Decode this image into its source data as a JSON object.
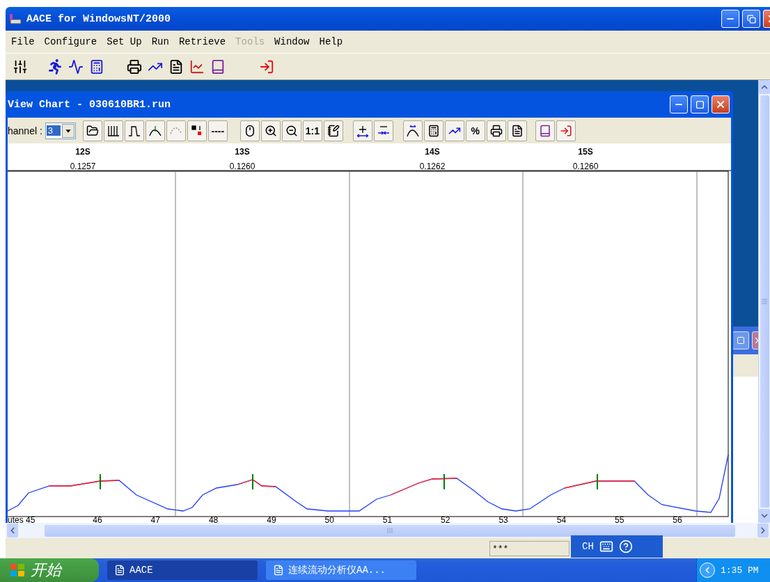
{
  "window": {
    "title": "AACE for WindowsNT/2000"
  },
  "menu": [
    {
      "label": "File",
      "disabled": false
    },
    {
      "label": "Configure",
      "disabled": false
    },
    {
      "label": "Set Up",
      "disabled": false
    },
    {
      "label": "Run",
      "disabled": false
    },
    {
      "label": "Retrieve",
      "disabled": false
    },
    {
      "label": "Tools",
      "disabled": true
    },
    {
      "label": "Window",
      "disabled": false
    },
    {
      "label": "Help",
      "disabled": false
    }
  ],
  "child_window": {
    "title": "View Chart - 030610BR1.run",
    "channel_label": "hannel :",
    "channel_value": "3",
    "toolbar_texts": [
      "----",
      "1:1",
      "%"
    ]
  },
  "chart": {
    "peaks": [
      {
        "name": "12S",
        "value": "0.1257"
      },
      {
        "name": "13S",
        "value": "0.1260"
      },
      {
        "name": "14S",
        "value": "0.1262"
      },
      {
        "name": "15S",
        "value": "0.1260"
      }
    ],
    "x_labels": [
      "utes 45",
      "46",
      "47",
      "48",
      "49",
      "50",
      "51",
      "52",
      "53",
      "54",
      "55",
      "56"
    ]
  },
  "status_bar": {
    "field": "***"
  },
  "language_bar": {
    "label": "CH"
  },
  "taskbar": {
    "start": "开始",
    "tasks": [
      {
        "label": "AACE",
        "selected": true
      },
      {
        "label": "连续流动分析仪AA...",
        "selected": false
      }
    ],
    "clock": "1:35 PM"
  }
}
